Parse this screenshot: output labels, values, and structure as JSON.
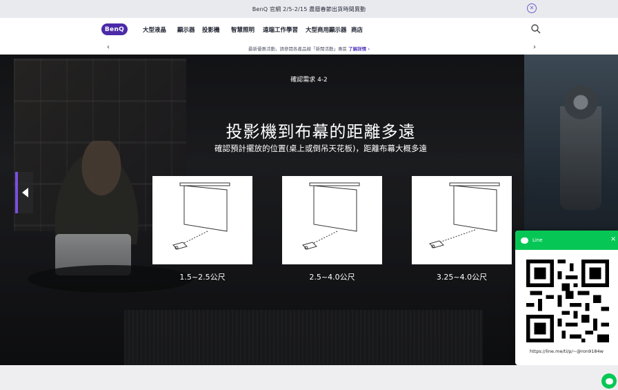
{
  "announcement": {
    "text": "BenQ 官網 2/5-2/15 農曆春節出貨時間異動"
  },
  "nav": {
    "logo": "BenQ",
    "items": [
      "大型液晶",
      "顯示器",
      "投影機",
      "智慧照明",
      "遠端工作學習",
      "大型商用顯示器",
      "商店"
    ]
  },
  "promo": {
    "prev": "‹",
    "next": "›",
    "text": "最新優惠活動，請參閱各產品線「新聞活動」專區 ",
    "link": "了解詳情 ›"
  },
  "hero": {
    "step": "確認需求 4-2",
    "title": "投影機到布幕的距離多遠",
    "subtitle": "確認預計擺放的位置(桌上或倒吊天花板)，距離布幕大概多遠",
    "cards": [
      {
        "label": "1.5~2.5公尺"
      },
      {
        "label": "2.5~4.0公尺"
      },
      {
        "label": "3.25~4.0公尺"
      }
    ]
  },
  "line_widget": {
    "title": "Line",
    "close": "×",
    "url": "https://line.me/ti/p/~@ron9184w"
  },
  "colors": {
    "brand": "#4b2aa8",
    "line_green": "#06c755",
    "accent": "#7b4fe0"
  },
  "icons": [
    "close-circle-icon",
    "search-icon",
    "chevron-left-icon",
    "chevron-right-icon",
    "line-chat-icon",
    "qr-code-icon"
  ]
}
